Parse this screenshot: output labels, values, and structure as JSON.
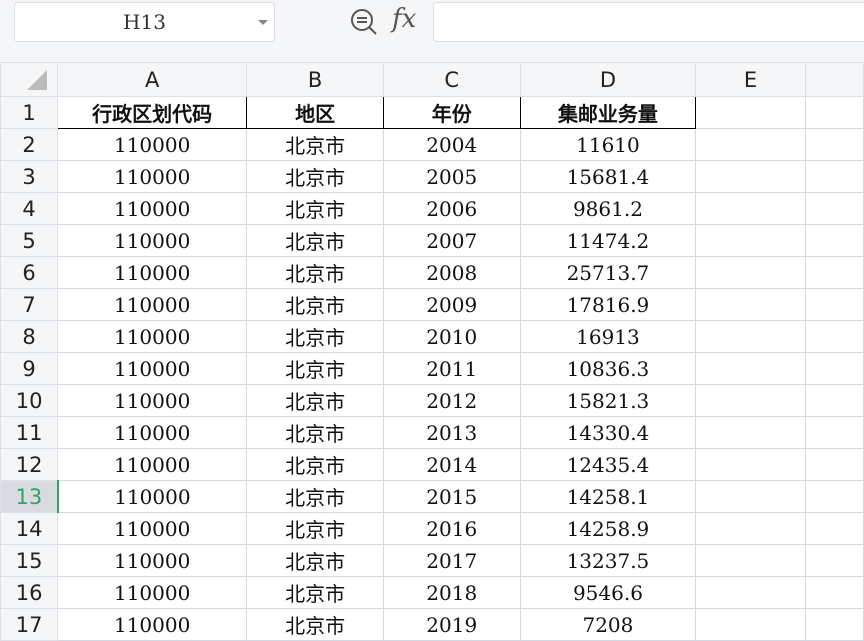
{
  "name_box": "H13",
  "formula_bar": {
    "fx_label": "fx",
    "value": ""
  },
  "columns": [
    "A",
    "B",
    "C",
    "D",
    "E"
  ],
  "header_row": [
    "行政区划代码",
    "地区",
    "年份",
    "集邮业务量"
  ],
  "rows": [
    [
      "110000",
      "北京市",
      "2004",
      "11610"
    ],
    [
      "110000",
      "北京市",
      "2005",
      "15681.4"
    ],
    [
      "110000",
      "北京市",
      "2006",
      "9861.2"
    ],
    [
      "110000",
      "北京市",
      "2007",
      "11474.2"
    ],
    [
      "110000",
      "北京市",
      "2008",
      "25713.7"
    ],
    [
      "110000",
      "北京市",
      "2009",
      "17816.9"
    ],
    [
      "110000",
      "北京市",
      "2010",
      "16913"
    ],
    [
      "110000",
      "北京市",
      "2011",
      "10836.3"
    ],
    [
      "110000",
      "北京市",
      "2012",
      "15821.3"
    ],
    [
      "110000",
      "北京市",
      "2013",
      "14330.4"
    ],
    [
      "110000",
      "北京市",
      "2014",
      "12435.4"
    ],
    [
      "110000",
      "北京市",
      "2015",
      "14258.1"
    ],
    [
      "110000",
      "北京市",
      "2016",
      "14258.9"
    ],
    [
      "110000",
      "北京市",
      "2017",
      "13237.5"
    ],
    [
      "110000",
      "北京市",
      "2018",
      "9546.6"
    ],
    [
      "110000",
      "北京市",
      "2019",
      "7208"
    ]
  ],
  "selected_row": 13
}
